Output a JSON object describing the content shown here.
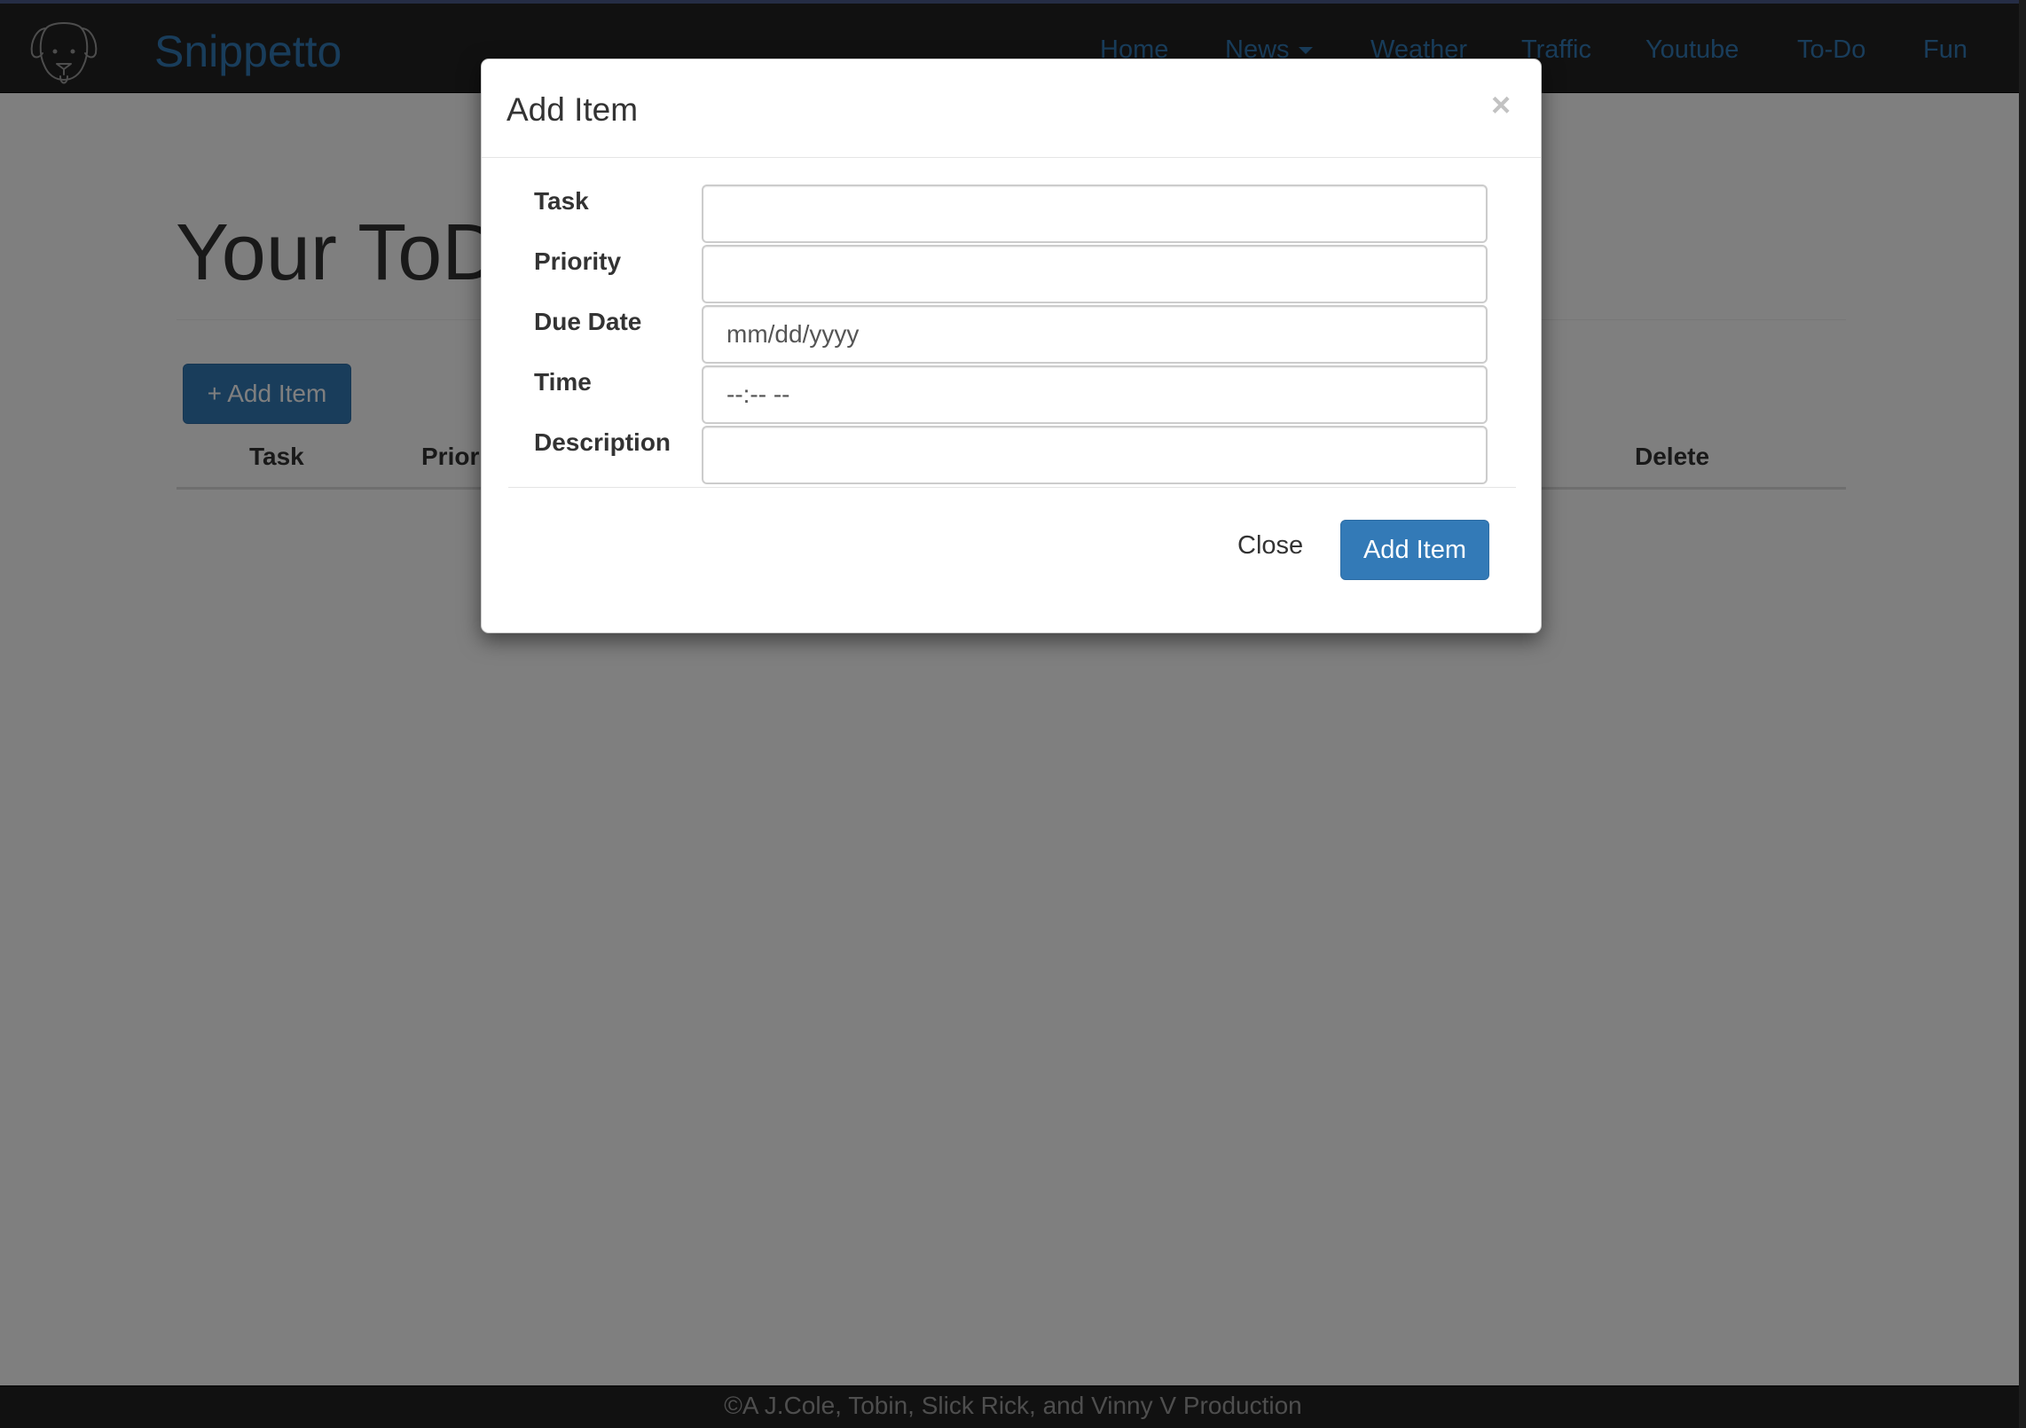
{
  "navbar": {
    "brand": "Snippetto",
    "logo_icon": "dog-face-icon",
    "links": {
      "home": "Home",
      "news": "News",
      "weather": "Weather",
      "traffic": "Traffic",
      "youtube": "Youtube",
      "todo": "To-Do",
      "fun": "Fun"
    }
  },
  "page": {
    "title": "Your ToDo",
    "add_button": "+ Add Item",
    "table_headers": {
      "task": "Task",
      "priority": "Priority",
      "delete": "Delete"
    }
  },
  "modal": {
    "title": "Add Item",
    "close_symbol": "×",
    "fields": {
      "task": {
        "label": "Task",
        "value": "",
        "placeholder": ""
      },
      "priority": {
        "label": "Priority",
        "value": "",
        "placeholder": ""
      },
      "due_date": {
        "label": "Due Date",
        "value": "",
        "placeholder": "mm/dd/yyyy"
      },
      "time": {
        "label": "Time",
        "value": "",
        "placeholder": "--:-- --"
      },
      "description": {
        "label": "Description",
        "value": "",
        "placeholder": ""
      }
    },
    "close_button": "Close",
    "submit_button": "Add Item"
  },
  "footer": {
    "text": "©A J.Cole, Tobin, Slick Rick, and Vinny V Production"
  },
  "colors": {
    "navbar_bg": "#222222",
    "link": "#337ab7",
    "primary_button": "#337ab7",
    "backdrop": "rgba(0,0,0,0.5)"
  }
}
